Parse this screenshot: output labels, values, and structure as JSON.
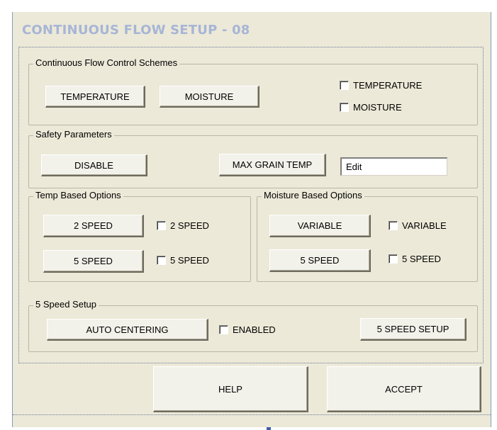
{
  "window": {
    "title": "CONTINUOUS FLOW SETUP - 08"
  },
  "control_schemes": {
    "legend": "Continuous Flow Control Schemes",
    "temperature_button": "TEMPERATURE",
    "moisture_button": "MOISTURE",
    "temperature_check": "TEMPERATURE",
    "moisture_check": "MOISTURE"
  },
  "safety": {
    "legend": "Safety Parameters",
    "disable_button": "DISABLE",
    "max_grain_temp_button": "MAX GRAIN TEMP",
    "edit_value": "Edit"
  },
  "temp_options": {
    "legend": "Temp Based Options",
    "two_speed_button": "2 SPEED",
    "two_speed_check": "2 SPEED",
    "five_speed_button": "5 SPEED",
    "five_speed_check": "5 SPEED"
  },
  "moisture_options": {
    "legend": "Moisture Based Options",
    "variable_button": "VARIABLE",
    "variable_check": "VARIABLE",
    "five_speed_button": "5 SPEED",
    "five_speed_check": "5 SPEED"
  },
  "five_speed_setup": {
    "legend": "5 Speed Setup",
    "auto_centering_button": "AUTO CENTERING",
    "enabled_check": "ENABLED",
    "setup_button": "5 SPEED SETUP"
  },
  "footer": {
    "help_button": "HELP",
    "accept_button": "ACCEPT"
  }
}
